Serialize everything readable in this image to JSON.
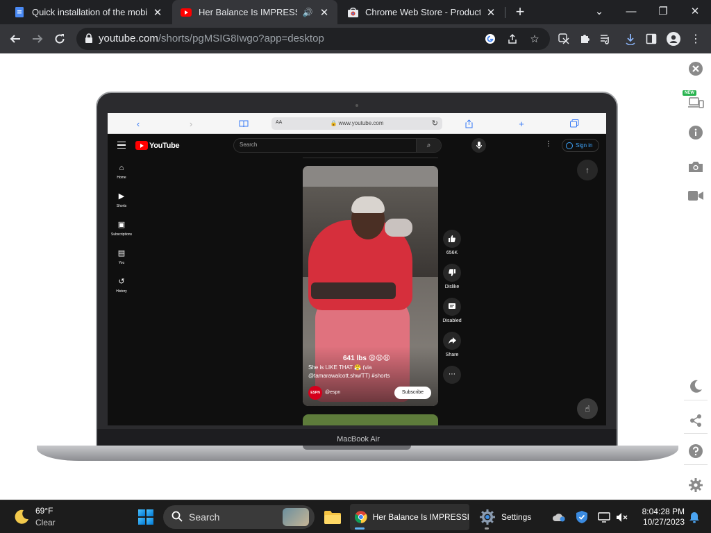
{
  "browser": {
    "tabs": [
      {
        "title": "Quick installation of the mobile",
        "active": false
      },
      {
        "title": "Her Balance Is IMPRESSIVE!",
        "active": true
      },
      {
        "title": "Chrome Web Store - Productivity",
        "active": false
      }
    ],
    "url_host": "youtube.com",
    "url_path": "/shorts/pgMSIG8Iwgo?app=desktop"
  },
  "device": {
    "label": "MacBook Air",
    "safari_aa": "AA",
    "safari_domain": "www.youtube.com"
  },
  "youtube": {
    "logo_text": "YouTube",
    "search_placeholder": "Search",
    "signin_label": "Sign in",
    "sidebar": [
      {
        "label": "Home",
        "icon": "home-icon",
        "glyph": "⌂"
      },
      {
        "label": "Shorts",
        "icon": "shorts-icon",
        "glyph": "▶"
      },
      {
        "label": "Subscriptions",
        "icon": "subscriptions-icon",
        "glyph": "▣"
      },
      {
        "label": "You",
        "icon": "library-icon",
        "glyph": "▤"
      },
      {
        "label": "History",
        "icon": "history-icon",
        "glyph": "↺"
      }
    ],
    "short": {
      "overlay_text": "641 lbs 😩😩😩",
      "caption": "She is LIKE THAT 😤 (via @tamarawalcott.shw/TT) #shorts",
      "channel_avatar_text": "ESPN",
      "channel": "@espn",
      "subscribe_label": "Subscribe"
    },
    "actions": [
      {
        "label": "656K",
        "icon": "like-icon",
        "glyph": "👍"
      },
      {
        "label": "Dislike",
        "icon": "dislike-icon",
        "glyph": "👎"
      },
      {
        "label": "Disabled",
        "icon": "comments-icon",
        "glyph": "▤"
      },
      {
        "label": "Share",
        "icon": "share-icon",
        "glyph": "➦"
      },
      {
        "label": "",
        "icon": "more-icon",
        "glyph": "⋯"
      }
    ]
  },
  "extension_panel": {
    "new_badge": "NEW",
    "icons": [
      "close-icon",
      "devices-icon",
      "info-icon",
      "camera-icon",
      "video-icon",
      "dark-mode-icon",
      "share-icon",
      "help-icon",
      "settings-icon"
    ]
  },
  "taskbar": {
    "weather_temp": "69°F",
    "weather_cond": "Clear",
    "search_label": "Search",
    "chrome_app_label": "Her Balance Is IMPRESSI",
    "settings_app_label": "Settings",
    "time": "8:04:28 PM",
    "date": "10/27/2023"
  }
}
